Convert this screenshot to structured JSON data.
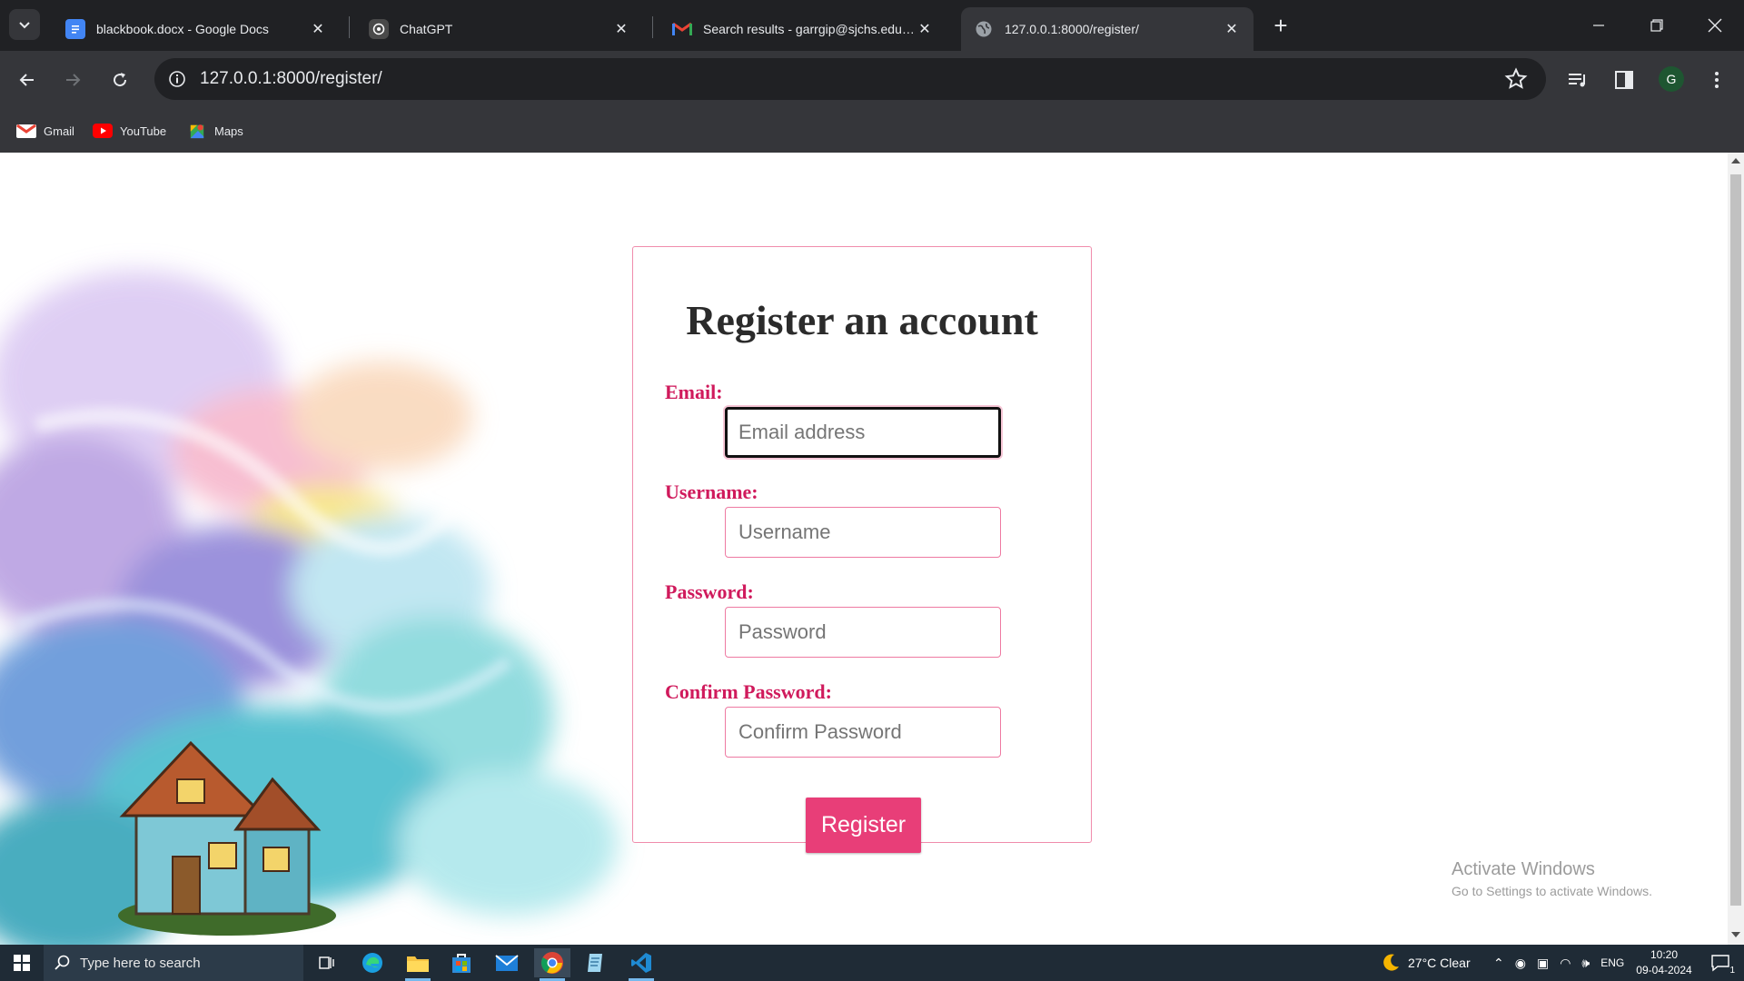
{
  "browser": {
    "tabs": [
      {
        "title": "blackbook.docx - Google Docs",
        "icon": "google-docs-icon"
      },
      {
        "title": "ChatGPT",
        "icon": "chatgpt-icon"
      },
      {
        "title": "Search results - garrgip@sjchs.edu.in - Al",
        "icon": "gmail-icon"
      },
      {
        "title": "127.0.0.1:8000/register/",
        "icon": "globe-icon",
        "active": true
      }
    ],
    "url": "127.0.0.1:8000/register/",
    "profile_initial": "G",
    "bookmarks": [
      {
        "label": "Gmail",
        "icon": "gmail-icon"
      },
      {
        "label": "YouTube",
        "icon": "youtube-icon"
      },
      {
        "label": "Maps",
        "icon": "maps-icon"
      }
    ]
  },
  "page": {
    "title": "Register an account",
    "fields": {
      "email": {
        "label": "Email:",
        "placeholder": "Email address",
        "value": ""
      },
      "username": {
        "label": "Username:",
        "placeholder": "Username",
        "value": ""
      },
      "password": {
        "label": "Password:",
        "placeholder": "Password",
        "value": ""
      },
      "confirm": {
        "label": "Confirm Password:",
        "placeholder": "Confirm Password",
        "value": ""
      }
    },
    "submit_label": "Register",
    "colors": {
      "accent": "#e83e78",
      "label": "#d01a5c",
      "border": "#f08cac"
    }
  },
  "watermark": {
    "line1": "Activate Windows",
    "line2": "Go to Settings to activate Windows."
  },
  "taskbar": {
    "search_placeholder": "Type here to search",
    "weather": "27°C  Clear",
    "language": "ENG",
    "time": "10:20",
    "date": "09-04-2024",
    "notification_count": "1"
  }
}
